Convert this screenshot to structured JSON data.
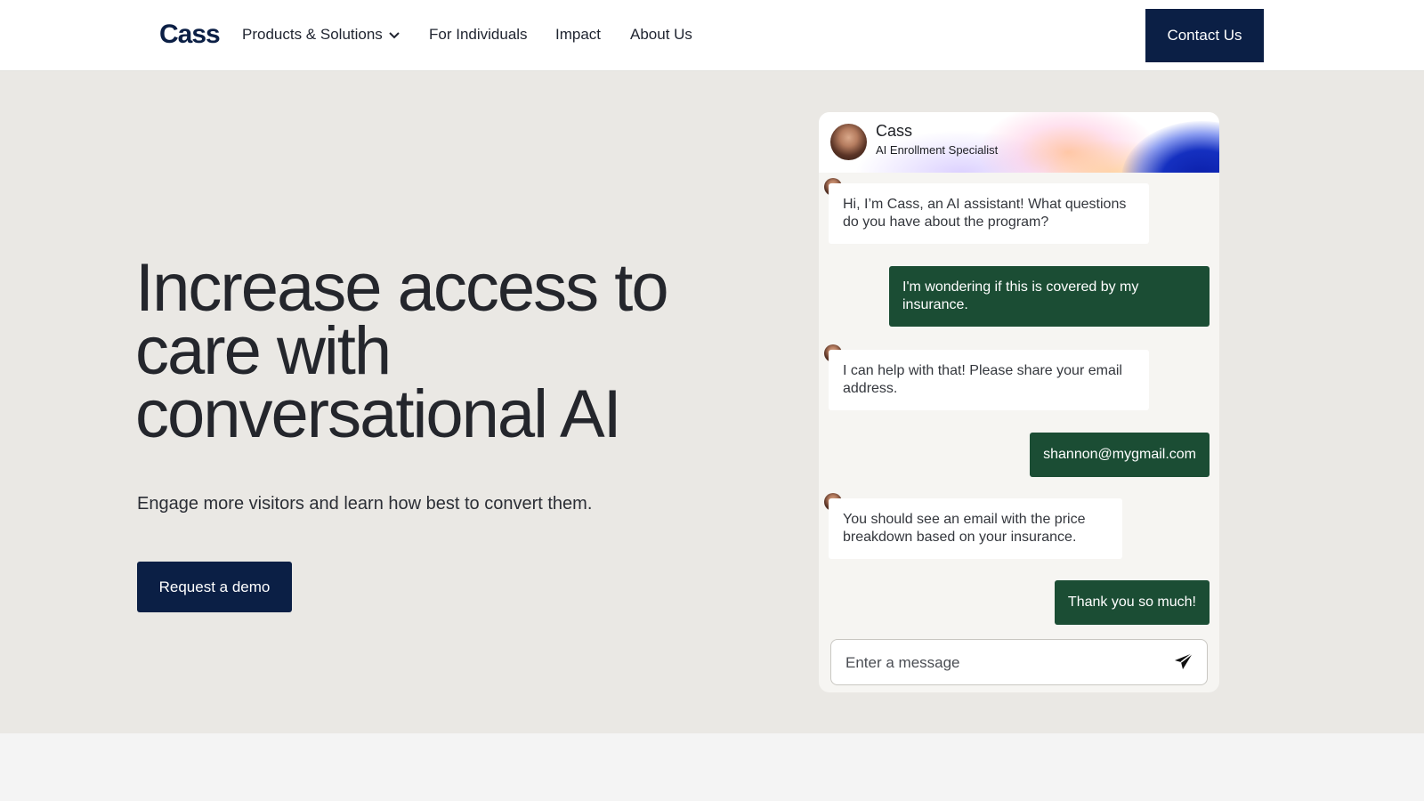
{
  "nav": {
    "logo": "Cass",
    "items": [
      {
        "label": "Products & Solutions"
      },
      {
        "label": "For Individuals"
      },
      {
        "label": "Impact"
      },
      {
        "label": "About Us"
      }
    ],
    "contact_label": "Contact Us"
  },
  "hero": {
    "headline": "Increase access to care with conversational AI",
    "subhead": "Engage more visitors and learn how best to convert them.",
    "cta_label": "Request a demo"
  },
  "chat": {
    "agent_name": "Cass",
    "agent_role": "AI Enrollment Specialist",
    "messages": [
      {
        "from": "bot",
        "text": "Hi, I’m Cass, an AI assistant! What questions do you have about the program?"
      },
      {
        "from": "user",
        "text": "I'm wondering if this is covered by my insurance."
      },
      {
        "from": "bot",
        "text": "I can help with that! Please share your email address."
      },
      {
        "from": "user",
        "text": "shannon@mygmail.com"
      },
      {
        "from": "bot",
        "text": "You should see an email with the price breakdown based on your insurance."
      },
      {
        "from": "user",
        "text": "Thank you so much!"
      }
    ],
    "input_placeholder": "Enter a message",
    "input_value": ""
  },
  "colors": {
    "brand_navy": "#0b1f45",
    "user_bubble": "#1b4d34",
    "hero_bg": "#eae8e4"
  },
  "icons": [
    "chevron-down-icon",
    "avatar",
    "send-icon"
  ]
}
